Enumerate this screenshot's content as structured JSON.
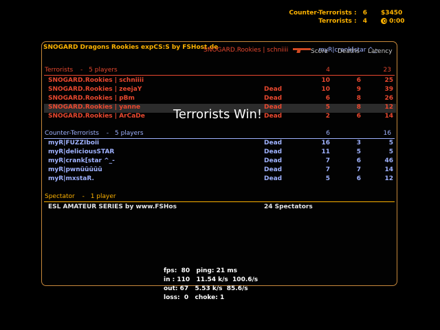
{
  "hud": {
    "ct_label": "Counter-Terrorists :",
    "ct_score": "6",
    "t_label": "Terrorists :",
    "t_score": "4",
    "money": "$3450",
    "timer": "0:00",
    "timer_icon": "stopwatch-icon"
  },
  "server_title": "SNOGARD Dragons Rookies expCS:S by FSHost.de",
  "killfeed": {
    "killer": "SNOGARD.Rookies | schniiii",
    "weapon_icon": "rifle-icon",
    "victim": "myR|crank[star ^_-"
  },
  "columns": {
    "score": "Score",
    "deaths": "Deaths",
    "latency": "Latency"
  },
  "teams": [
    {
      "key": "t",
      "label": "Terrorists",
      "dash": "-",
      "count": "5 players",
      "score": "4",
      "latency": "23",
      "color": "#e9482f",
      "players": [
        {
          "name": "SNOGARD.Rookies | schniiii",
          "status": "",
          "score": "10",
          "deaths": "6",
          "latency": "25"
        },
        {
          "name": "SNOGARD.Rookies | zeejaY",
          "status": "Dead",
          "score": "10",
          "deaths": "9",
          "latency": "39"
        },
        {
          "name": "SNOGARD.Rookies | pBm",
          "status": "Dead",
          "score": "6",
          "deaths": "8",
          "latency": "26"
        },
        {
          "name": "SNOGARD.Rookies | yanne",
          "status": "Dead",
          "score": "5",
          "deaths": "8",
          "latency": "12",
          "highlight": true
        },
        {
          "name": "SNOGARD.Rookies | ArCaDe",
          "status": "Dead",
          "score": "2",
          "deaths": "6",
          "latency": "14"
        }
      ]
    },
    {
      "key": "ct",
      "label": "Counter-Terrorists",
      "dash": "-",
      "count": "5 players",
      "score": "6",
      "latency": "16",
      "color": "#9fb2ff",
      "players": [
        {
          "name": "myR|FUZZIboii",
          "status": "Dead",
          "score": "16",
          "deaths": "3",
          "latency": "5"
        },
        {
          "name": "myR|deliciousSTAR",
          "status": "Dead",
          "score": "11",
          "deaths": "5",
          "latency": "5"
        },
        {
          "name": "myR|crank[star ^_-",
          "status": "Dead",
          "score": "7",
          "deaths": "6",
          "latency": "46"
        },
        {
          "name": "myR|pwnüüüüü",
          "status": "Dead",
          "score": "7",
          "deaths": "7",
          "latency": "14"
        },
        {
          "name": "myR|mxstaR.",
          "status": "Dead",
          "score": "5",
          "deaths": "6",
          "latency": "12"
        }
      ]
    }
  ],
  "spectator": {
    "label": "Spectator",
    "dash": "-",
    "count": "1 player",
    "name": "ESL AMATEUR SERIES by www.FSHos",
    "status": "24 Spectators"
  },
  "round_message": "Terrorists Win!",
  "netgraph": {
    "line1": "fps:  80   ping: 21 ms",
    "line2": "in : 110   11.54 k/s  100.6/s",
    "line3": "out: 67   5.53 k/s  85.6/s",
    "line4": "loss:  0   choke: 1"
  }
}
